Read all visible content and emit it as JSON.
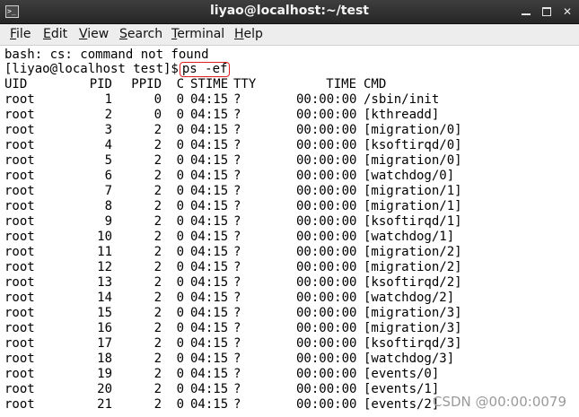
{
  "window": {
    "title": "liyao@localhost:~/test",
    "app_icon": "terminal-icon"
  },
  "menu": [
    {
      "mnemonic": "F",
      "rest": "ile"
    },
    {
      "mnemonic": "E",
      "rest": "dit"
    },
    {
      "mnemonic": "V",
      "rest": "iew"
    },
    {
      "mnemonic": "S",
      "rest": "earch"
    },
    {
      "mnemonic": "T",
      "rest": "erminal"
    },
    {
      "mnemonic": "H",
      "rest": "elp"
    }
  ],
  "terminal": {
    "error_line": "bash: cs: command not found",
    "prompt": "[liyao@localhost test]$",
    "command": "ps -ef",
    "headers": {
      "uid": "UID",
      "pid": "PID",
      "ppid": "PPID",
      "c": "C",
      "stime": "STIME",
      "tty": "TTY",
      "time": "TIME",
      "cmd": "CMD"
    },
    "rows": [
      {
        "uid": "root",
        "pid": "1",
        "ppid": "0",
        "c": "0",
        "stime": "04:15",
        "tty": "?",
        "time": "00:00:00",
        "cmd": "/sbin/init"
      },
      {
        "uid": "root",
        "pid": "2",
        "ppid": "0",
        "c": "0",
        "stime": "04:15",
        "tty": "?",
        "time": "00:00:00",
        "cmd": "[kthreadd]"
      },
      {
        "uid": "root",
        "pid": "3",
        "ppid": "2",
        "c": "0",
        "stime": "04:15",
        "tty": "?",
        "time": "00:00:00",
        "cmd": "[migration/0]"
      },
      {
        "uid": "root",
        "pid": "4",
        "ppid": "2",
        "c": "0",
        "stime": "04:15",
        "tty": "?",
        "time": "00:00:00",
        "cmd": "[ksoftirqd/0]"
      },
      {
        "uid": "root",
        "pid": "5",
        "ppid": "2",
        "c": "0",
        "stime": "04:15",
        "tty": "?",
        "time": "00:00:00",
        "cmd": "[migration/0]"
      },
      {
        "uid": "root",
        "pid": "6",
        "ppid": "2",
        "c": "0",
        "stime": "04:15",
        "tty": "?",
        "time": "00:00:00",
        "cmd": "[watchdog/0]"
      },
      {
        "uid": "root",
        "pid": "7",
        "ppid": "2",
        "c": "0",
        "stime": "04:15",
        "tty": "?",
        "time": "00:00:00",
        "cmd": "[migration/1]"
      },
      {
        "uid": "root",
        "pid": "8",
        "ppid": "2",
        "c": "0",
        "stime": "04:15",
        "tty": "?",
        "time": "00:00:00",
        "cmd": "[migration/1]"
      },
      {
        "uid": "root",
        "pid": "9",
        "ppid": "2",
        "c": "0",
        "stime": "04:15",
        "tty": "?",
        "time": "00:00:00",
        "cmd": "[ksoftirqd/1]"
      },
      {
        "uid": "root",
        "pid": "10",
        "ppid": "2",
        "c": "0",
        "stime": "04:15",
        "tty": "?",
        "time": "00:00:00",
        "cmd": "[watchdog/1]"
      },
      {
        "uid": "root",
        "pid": "11",
        "ppid": "2",
        "c": "0",
        "stime": "04:15",
        "tty": "?",
        "time": "00:00:00",
        "cmd": "[migration/2]"
      },
      {
        "uid": "root",
        "pid": "12",
        "ppid": "2",
        "c": "0",
        "stime": "04:15",
        "tty": "?",
        "time": "00:00:00",
        "cmd": "[migration/2]"
      },
      {
        "uid": "root",
        "pid": "13",
        "ppid": "2",
        "c": "0",
        "stime": "04:15",
        "tty": "?",
        "time": "00:00:00",
        "cmd": "[ksoftirqd/2]"
      },
      {
        "uid": "root",
        "pid": "14",
        "ppid": "2",
        "c": "0",
        "stime": "04:15",
        "tty": "?",
        "time": "00:00:00",
        "cmd": "[watchdog/2]"
      },
      {
        "uid": "root",
        "pid": "15",
        "ppid": "2",
        "c": "0",
        "stime": "04:15",
        "tty": "?",
        "time": "00:00:00",
        "cmd": "[migration/3]"
      },
      {
        "uid": "root",
        "pid": "16",
        "ppid": "2",
        "c": "0",
        "stime": "04:15",
        "tty": "?",
        "time": "00:00:00",
        "cmd": "[migration/3]"
      },
      {
        "uid": "root",
        "pid": "17",
        "ppid": "2",
        "c": "0",
        "stime": "04:15",
        "tty": "?",
        "time": "00:00:00",
        "cmd": "[ksoftirqd/3]"
      },
      {
        "uid": "root",
        "pid": "18",
        "ppid": "2",
        "c": "0",
        "stime": "04:15",
        "tty": "?",
        "time": "00:00:00",
        "cmd": "[watchdog/3]"
      },
      {
        "uid": "root",
        "pid": "19",
        "ppid": "2",
        "c": "0",
        "stime": "04:15",
        "tty": "?",
        "time": "00:00:00",
        "cmd": "[events/0]"
      },
      {
        "uid": "root",
        "pid": "20",
        "ppid": "2",
        "c": "0",
        "stime": "04:15",
        "tty": "?",
        "time": "00:00:00",
        "cmd": "[events/1]"
      },
      {
        "uid": "root",
        "pid": "21",
        "ppid": "2",
        "c": "0",
        "stime": "04:15",
        "tty": "?",
        "time": "00:00:00",
        "cmd": "[events/2]"
      }
    ]
  },
  "watermark": "CSDN @00:00:0079",
  "colors": {
    "titlebar": "#2e2e2e",
    "highlight_box": "#e02020",
    "watermark": "#9a9a9a"
  }
}
